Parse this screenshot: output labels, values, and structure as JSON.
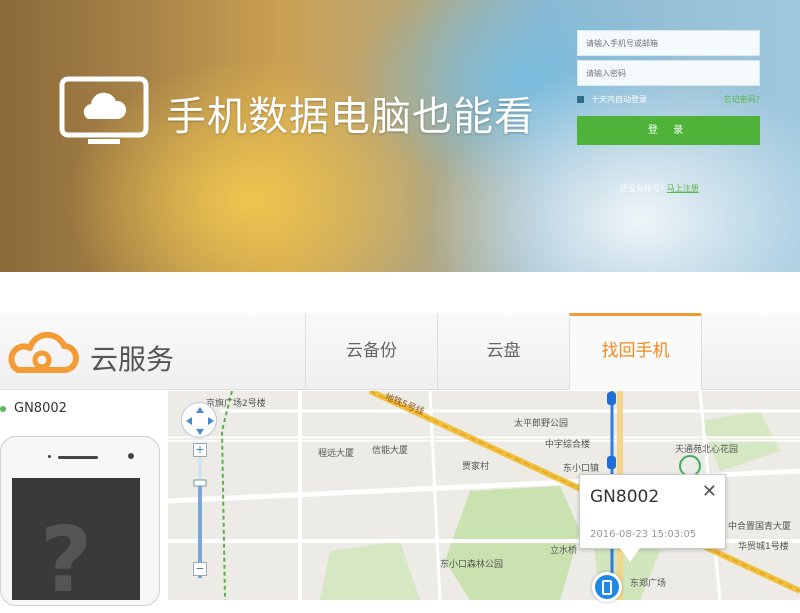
{
  "hero": {
    "title": "手机数据电脑也能看",
    "logo_icon": "monitor-cloud-icon",
    "login": {
      "account_placeholder": "请输入手机号或邮箱",
      "password_placeholder": "请输入密码",
      "remember_label": "十天内自动登录",
      "forgot_label": "忘记密码?",
      "login_button": "登 录",
      "register_prefix": "还没有账号?",
      "register_link": "马上注册"
    },
    "accent_color": "#4fb33a"
  },
  "nav": {
    "brand": "云服务",
    "brand_icon": "cloud-logo-icon",
    "tabs": [
      {
        "label": "云备份",
        "active": false
      },
      {
        "label": "云盘",
        "active": false
      },
      {
        "label": "找回手机",
        "active": true
      }
    ],
    "active_color": "#f08a1e"
  },
  "device": {
    "name": "GN8002",
    "status": "online"
  },
  "map": {
    "labels": [
      "京旗广场2号楼",
      "程远大厦",
      "信能大厦",
      "贾家村",
      "太平郎野公园",
      "中宇综合楼",
      "东小口镇",
      "天通苑北心花园",
      "中合置国青大厦",
      "华贸城1号楼",
      "东小口森林公园",
      "立水桥",
      "东郑广场"
    ],
    "road_labels": [
      "地铁5号线"
    ],
    "popup": {
      "title": "GN8002",
      "time": "2016-08-23 15:03:05"
    }
  }
}
